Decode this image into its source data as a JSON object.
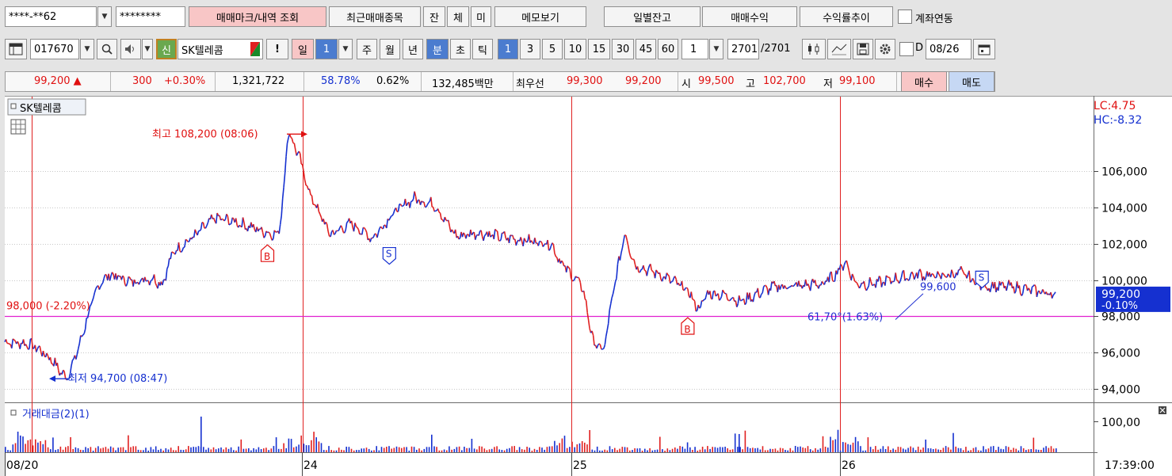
{
  "toolbar1": {
    "account": "****-**62",
    "password": "********",
    "btn_trade_mark": "매매마크/내역 조회",
    "btn_recent_items": "최근매매종목",
    "btn_jan": "잔",
    "btn_che": "체",
    "btn_mi": "미",
    "btn_memo": "메모보기",
    "btn_daily_balance": "일별잔고",
    "btn_trade_profit": "매매수익",
    "btn_yield_trend": "수익률추이",
    "account_link_label": "계좌연동"
  },
  "toolbar2": {
    "code": "017670",
    "sin_badge": "신",
    "stock_name": "SK텔레콤",
    "warn": "!",
    "period_il": "일",
    "period_num": "1",
    "period_ju": "주",
    "period_wol": "월",
    "period_nyeon": "년",
    "period_bun": "분",
    "period_cho": "초",
    "period_tik": "틱",
    "minute_options": [
      "1",
      "3",
      "5",
      "10",
      "15",
      "30",
      "45",
      "60"
    ],
    "unit_value": "1",
    "count_value": "2701",
    "count_total": "/2701",
    "date_prefix": "D",
    "date_value": "08/26"
  },
  "quote": {
    "price": "99,200",
    "change": "300",
    "change_rate": "+0.30%",
    "volume": "1,321,722",
    "ratio1": "58.78%",
    "ratio2": "0.62%",
    "amount": "132,485백만",
    "best_label": "최우선",
    "best_ask": "99,300",
    "best_bid": "99,200",
    "open_label": "시",
    "open": "99,500",
    "high_label": "고",
    "high": "102,700",
    "low_label": "저",
    "low": "99,100",
    "buy_btn": "매수",
    "sell_btn": "매도"
  },
  "colors": {
    "up": "#e01010",
    "down": "#1530d0",
    "line": "#e02020",
    "hline": "#e020d0"
  },
  "chart_data": {
    "type": "line",
    "title": "SK텔레콤",
    "lc_label": "LC:4.75",
    "hc_label": "HC:-8.32",
    "y_ticks": [
      "106,000",
      "104,000",
      "102,000",
      "100,000",
      "98,000",
      "96,000",
      "94,000"
    ],
    "y_tick_values": [
      106000,
      104000,
      102000,
      100000,
      98000,
      96000,
      94000
    ],
    "ylim": [
      93400,
      110000
    ],
    "current_price_label": "99,200",
    "current_change_label": "-0.10%",
    "high_annotation": "최고 108,200 (08:06)",
    "low_annotation": "최저 94,700 (08:47)",
    "hline_value": 98000,
    "hline_label": "98,000 (-2.20%)",
    "trend_label_1": "99,600",
    "trend_label_2": "61,70°(1.63%)",
    "markers": [
      {
        "label": "B",
        "type": "buy",
        "idx": 0.25,
        "price": 101800
      },
      {
        "label": "S",
        "type": "sell",
        "idx": 0.366,
        "price": 101000
      },
      {
        "label": "B",
        "type": "buy",
        "idx": 0.65,
        "price": 97800
      },
      {
        "label": "S",
        "type": "sell",
        "idx": 0.93,
        "price": 99700
      }
    ],
    "volume_title": "거래대금(2)(1)",
    "volume_tick": "100,00",
    "x_labels": [
      "08/20",
      "24",
      "25",
      "26"
    ],
    "time_label": "17:39:00",
    "price_anchors": [
      [
        0,
        96600
      ],
      [
        0.02,
        96500
      ],
      [
        0.03,
        96300
      ],
      [
        0.045,
        95600
      ],
      [
        0.055,
        94800
      ],
      [
        0.06,
        94700
      ],
      [
        0.07,
        96200
      ],
      [
        0.08,
        98200
      ],
      [
        0.09,
        99800
      ],
      [
        0.1,
        100300
      ],
      [
        0.12,
        99900
      ],
      [
        0.14,
        100100
      ],
      [
        0.15,
        99800
      ],
      [
        0.16,
        101500
      ],
      [
        0.18,
        102400
      ],
      [
        0.2,
        103400
      ],
      [
        0.22,
        103200
      ],
      [
        0.24,
        102800
      ],
      [
        0.25,
        102600
      ],
      [
        0.26,
        102500
      ],
      [
        0.263,
        103500
      ],
      [
        0.27,
        108200
      ],
      [
        0.28,
        106800
      ],
      [
        0.29,
        104800
      ],
      [
        0.3,
        103600
      ],
      [
        0.31,
        102500
      ],
      [
        0.33,
        103100
      ],
      [
        0.35,
        102300
      ],
      [
        0.37,
        103700
      ],
      [
        0.39,
        104500
      ],
      [
        0.41,
        104100
      ],
      [
        0.42,
        103200
      ],
      [
        0.43,
        102400
      ],
      [
        0.45,
        102600
      ],
      [
        0.48,
        102300
      ],
      [
        0.52,
        102000
      ],
      [
        0.53,
        100900
      ],
      [
        0.55,
        99600
      ],
      [
        0.56,
        96600
      ],
      [
        0.57,
        96100
      ],
      [
        0.58,
        99600
      ],
      [
        0.59,
        102600
      ],
      [
        0.6,
        100800
      ],
      [
        0.62,
        100400
      ],
      [
        0.64,
        99800
      ],
      [
        0.65,
        99400
      ],
      [
        0.66,
        98400
      ],
      [
        0.67,
        99300
      ],
      [
        0.69,
        99100
      ],
      [
        0.7,
        98800
      ],
      [
        0.73,
        99600
      ],
      [
        0.76,
        99700
      ],
      [
        0.78,
        99800
      ],
      [
        0.79,
        100300
      ],
      [
        0.8,
        101000
      ],
      [
        0.81,
        99800
      ],
      [
        0.83,
        99800
      ],
      [
        0.85,
        100100
      ],
      [
        0.87,
        100300
      ],
      [
        0.89,
        100200
      ],
      [
        0.91,
        100400
      ],
      [
        0.93,
        99700
      ],
      [
        0.96,
        99600
      ],
      [
        1,
        99200
      ]
    ]
  }
}
